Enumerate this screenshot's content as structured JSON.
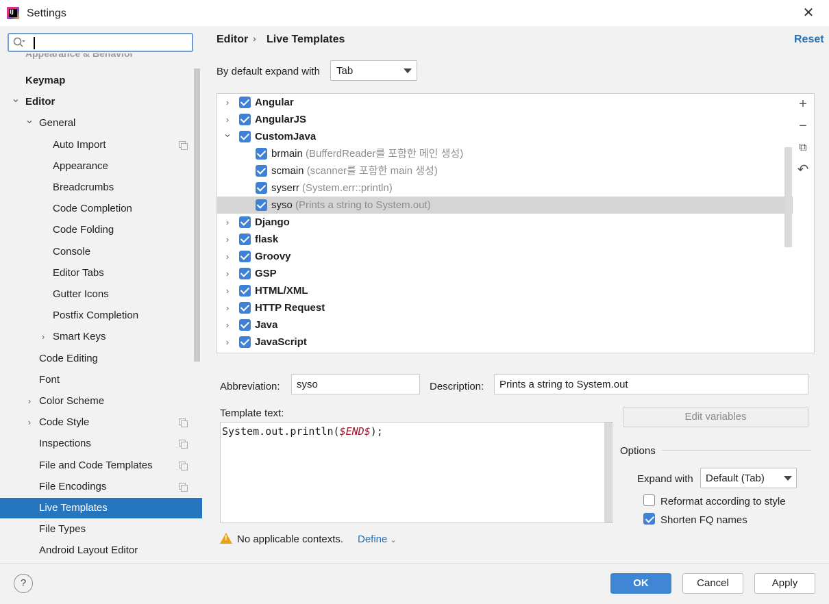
{
  "window": {
    "title": "Settings"
  },
  "sidebar": {
    "faded_item": "Appearance & Behavior",
    "items": [
      {
        "label": "Keymap",
        "level": 0,
        "bold": true
      },
      {
        "label": "Editor",
        "level": 0,
        "bold": true,
        "expanded": true
      },
      {
        "label": "General",
        "level": 1,
        "expanded": true
      },
      {
        "label": "Auto Import",
        "level": 2,
        "copy": true
      },
      {
        "label": "Appearance",
        "level": 2
      },
      {
        "label": "Breadcrumbs",
        "level": 2
      },
      {
        "label": "Code Completion",
        "level": 2
      },
      {
        "label": "Code Folding",
        "level": 2
      },
      {
        "label": "Console",
        "level": 2
      },
      {
        "label": "Editor Tabs",
        "level": 2
      },
      {
        "label": "Gutter Icons",
        "level": 2
      },
      {
        "label": "Postfix Completion",
        "level": 2
      },
      {
        "label": "Smart Keys",
        "level": 2,
        "collapsed": true
      },
      {
        "label": "Code Editing",
        "level": 1
      },
      {
        "label": "Font",
        "level": 1
      },
      {
        "label": "Color Scheme",
        "level": 1,
        "collapsed": true
      },
      {
        "label": "Code Style",
        "level": 1,
        "collapsed": true,
        "copy": true
      },
      {
        "label": "Inspections",
        "level": 1,
        "copy": true
      },
      {
        "label": "File and Code Templates",
        "level": 1,
        "copy": true
      },
      {
        "label": "File Encodings",
        "level": 1,
        "copy": true
      },
      {
        "label": "Live Templates",
        "level": 1,
        "selected": true
      },
      {
        "label": "File Types",
        "level": 1
      },
      {
        "label": "Android Layout Editor",
        "level": 1
      }
    ]
  },
  "header": {
    "crumb1": "Editor",
    "crumb2": "Live Templates",
    "reset": "Reset"
  },
  "expand_default": {
    "label": "By default expand with",
    "value": "Tab"
  },
  "templates": [
    {
      "name": "Angular",
      "type": "group",
      "state": "collapsed"
    },
    {
      "name": "AngularJS",
      "type": "group",
      "state": "collapsed"
    },
    {
      "name": "CustomJava",
      "type": "group",
      "state": "expanded"
    },
    {
      "name": "brmain",
      "desc": "(BufferdReader를 포함한 메인 생성)",
      "type": "item"
    },
    {
      "name": "scmain",
      "desc": "(scanner를 포함한 main 생성)",
      "type": "item"
    },
    {
      "name": "syserr",
      "desc": "(System.err::println)",
      "type": "item"
    },
    {
      "name": "syso",
      "desc": "(Prints a string to System.out)",
      "type": "item",
      "selected": true
    },
    {
      "name": "Django",
      "type": "group",
      "state": "collapsed"
    },
    {
      "name": "flask",
      "type": "group",
      "state": "collapsed"
    },
    {
      "name": "Groovy",
      "type": "group",
      "state": "collapsed"
    },
    {
      "name": "GSP",
      "type": "group",
      "state": "collapsed"
    },
    {
      "name": "HTML/XML",
      "type": "group",
      "state": "collapsed"
    },
    {
      "name": "HTTP Request",
      "type": "group",
      "state": "collapsed"
    },
    {
      "name": "Java",
      "type": "group",
      "state": "collapsed"
    },
    {
      "name": "JavaScript",
      "type": "group",
      "state": "collapsed"
    }
  ],
  "tools": {
    "add": "+",
    "remove": "−",
    "copy": "⧉",
    "revert": "↶"
  },
  "editor": {
    "abbr_label": "Abbreviation:",
    "abbr_value": "syso",
    "desc_label": "Description:",
    "desc_value": "Prints a string to System.out",
    "template_label": "Template text:",
    "template_prefix": "System.out.println(",
    "template_var": "$END$",
    "template_suffix": ");",
    "edit_variables": "Edit variables"
  },
  "options": {
    "title": "Options",
    "expand_label": "Expand with",
    "expand_value": "Default (Tab)",
    "reformat": "Reformat according to style",
    "reformat_checked": false,
    "shorten": "Shorten FQ names",
    "shorten_checked": true
  },
  "context": {
    "warning": "No applicable contexts.",
    "define": "Define"
  },
  "buttons": {
    "help": "?",
    "ok": "OK",
    "cancel": "Cancel",
    "apply": "Apply"
  },
  "colors": {
    "accent": "#2675bf",
    "checkbox": "#3d82d6",
    "link": "#2470b3",
    "warning": "#e8a317"
  }
}
